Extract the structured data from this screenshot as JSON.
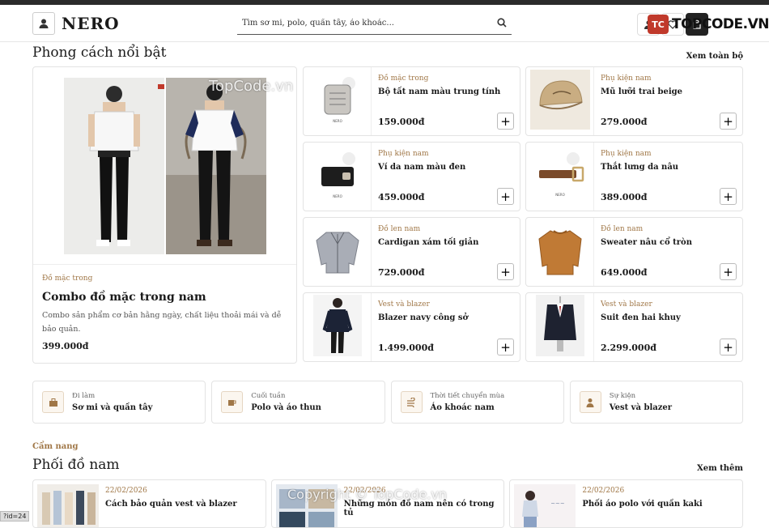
{
  "header": {
    "logo_text": "NERO",
    "search_placeholder": "Tìm sơ mi, polo, quần tây, áo khoác..."
  },
  "watermarks": {
    "top": "TOPCODE.VN",
    "badge": "TC",
    "overlay": "TopCode.vn",
    "bottom": "Copyright © TopCode.vn"
  },
  "featured_section": {
    "title": "Phong cách nổi bật",
    "see_all": "Xem toàn bộ"
  },
  "feature": {
    "category": "Đồ mặc trong",
    "title": "Combo đồ mặc trong nam",
    "description": "Combo sản phẩm cơ bản hằng ngày, chất liệu thoải mái và dễ bảo quản.",
    "price": "399.000đ"
  },
  "products": [
    {
      "category": "Đồ mặc trong",
      "name": "Bộ tất nam màu trung tính",
      "price": "159.000đ",
      "icon": "socks-icon"
    },
    {
      "category": "Phụ kiện nam",
      "name": "Mũ lưỡi trai beige",
      "price": "279.000đ",
      "icon": "cap-icon"
    },
    {
      "category": "Phụ kiện nam",
      "name": "Ví da nam màu đen",
      "price": "459.000đ",
      "icon": "wallet-icon"
    },
    {
      "category": "Phụ kiện nam",
      "name": "Thắt lưng da nâu",
      "price": "389.000đ",
      "icon": "belt-icon"
    },
    {
      "category": "Đồ len nam",
      "name": "Cardigan xám tối giản",
      "price": "729.000đ",
      "icon": "cardigan-icon"
    },
    {
      "category": "Đồ len nam",
      "name": "Sweater nâu cổ tròn",
      "price": "649.000đ",
      "icon": "sweater-icon"
    },
    {
      "category": "Vest và blazer",
      "name": "Blazer navy công sở",
      "price": "1.499.000đ",
      "icon": "blazer-icon"
    },
    {
      "category": "Vest và blazer",
      "name": "Suit đen hai khuy",
      "price": "2.299.000đ",
      "icon": "suit-icon"
    }
  ],
  "product_brand_mark": "NERO",
  "occasions": [
    {
      "sub": "Đi làm",
      "main": "Sơ mi và quần tây",
      "icon": "briefcase-icon"
    },
    {
      "sub": "Cuối tuần",
      "main": "Polo và áo thun",
      "icon": "coffee-icon"
    },
    {
      "sub": "Thời tiết chuyển mùa",
      "main": "Áo khoác nam",
      "icon": "wind-icon"
    },
    {
      "sub": "Sự kiện",
      "main": "Vest và blazer",
      "icon": "person-icon"
    }
  ],
  "guide": {
    "eyebrow": "Cẩm nang",
    "title": "Phối đồ nam",
    "see_more": "Xem thêm"
  },
  "posts": [
    {
      "date": "22/02/2026",
      "title": "Cách bảo quản vest và blazer"
    },
    {
      "date": "22/02/2026",
      "title": "Những món đồ nam nên có trong tủ"
    },
    {
      "date": "22/02/2026",
      "title": "Phối áo polo với quần kaki"
    }
  ],
  "status_text": "?id=24",
  "colors": {
    "accent": "#a07747",
    "border": "#e3e3e3",
    "dark": "#222222"
  }
}
